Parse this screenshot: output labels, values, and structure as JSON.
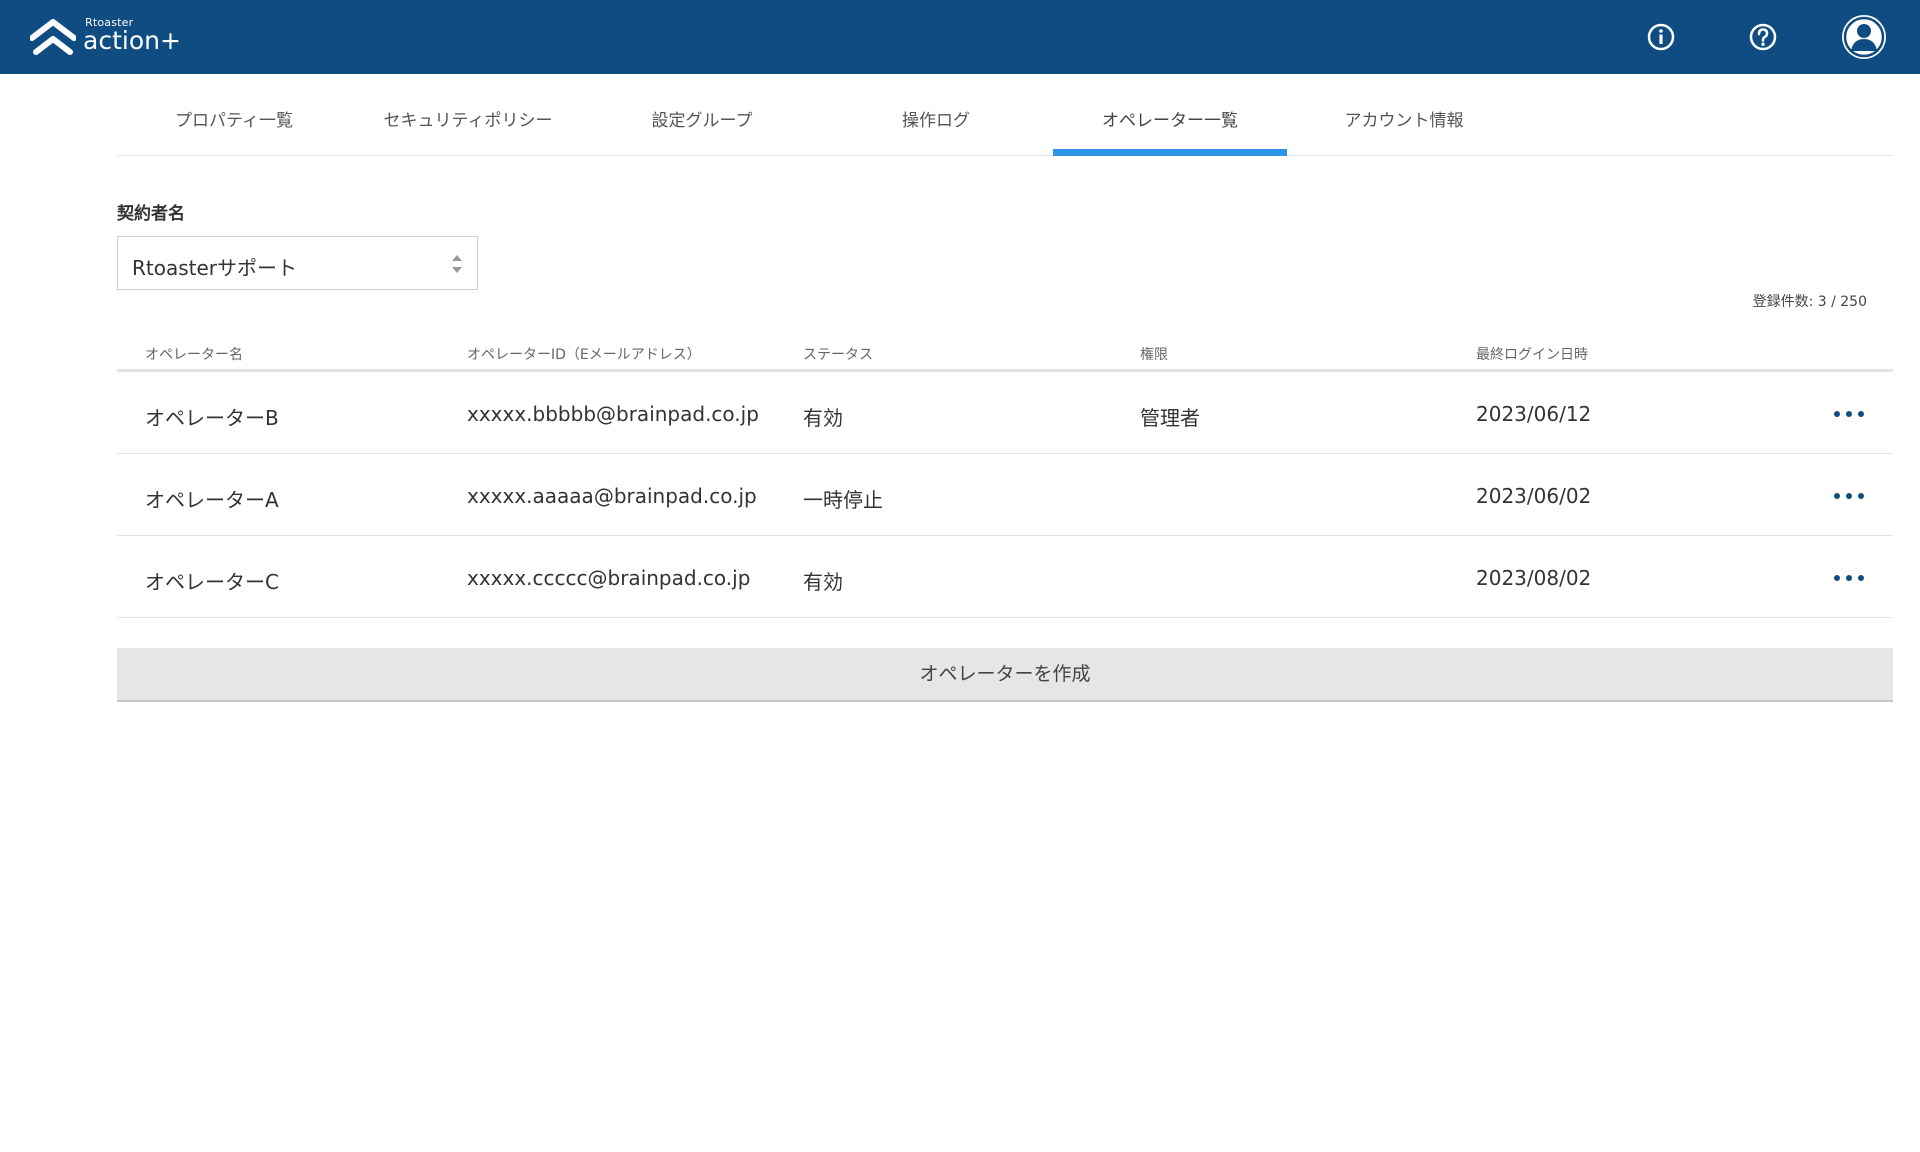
{
  "header": {
    "logo_small": "Rtoaster",
    "logo_big": "action+",
    "icons": [
      "info-icon",
      "help-icon",
      "user-avatar-icon"
    ],
    "bg_color": "#0f4c81"
  },
  "tabs": [
    {
      "label": "プロパティ一覧",
      "active": false
    },
    {
      "label": "セキュリティポリシー",
      "active": false
    },
    {
      "label": "設定グループ",
      "active": false
    },
    {
      "label": "操作ログ",
      "active": false
    },
    {
      "label": "オペレーター一覧",
      "active": true
    },
    {
      "label": "アカウント情報",
      "active": false
    }
  ],
  "contract": {
    "label": "契約者名",
    "selected": "Rtoasterサポート"
  },
  "count_text": "登録件数: 3 / 250",
  "table": {
    "headers": [
      "オペレーター名",
      "オペレーターID（Eメールアドレス）",
      "ステータス",
      "権限",
      "最終ログイン日時"
    ],
    "rows": [
      {
        "name": "オペレーターB",
        "id": "xxxxx.bbbbb@brainpad.co.jp",
        "status": "有効",
        "role": "管理者",
        "last_login": "2023/06/12"
      },
      {
        "name": "オペレーターA",
        "id": "xxxxx.aaaaa@brainpad.co.jp",
        "status": "一時停止",
        "role": "",
        "last_login": "2023/06/02"
      },
      {
        "name": "オペレーターC",
        "id": "xxxxx.ccccc@brainpad.co.jp",
        "status": "有効",
        "role": "",
        "last_login": "2023/08/02"
      }
    ]
  },
  "create_button": "オペレーターを作成",
  "accent_color": "#2e96ea"
}
